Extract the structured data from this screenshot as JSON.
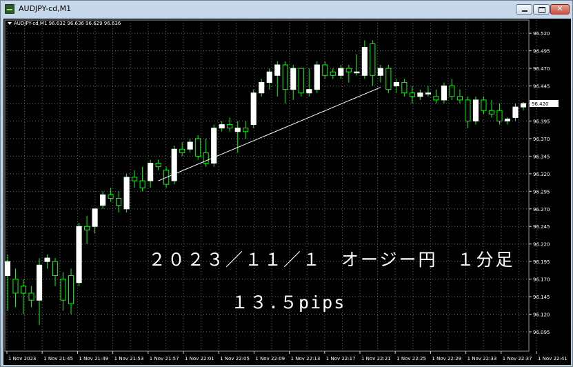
{
  "window": {
    "title": "AUDJPY-cd,M1"
  },
  "chart": {
    "info_line": "AUDJPY-cd,M1  96.632 96.636 96.629 96.636",
    "annotation_title": "２０２３／１１／１　オージー円　１分足",
    "annotation_pips": "１３.５pips"
  },
  "chart_data": {
    "type": "candlestick",
    "symbol": "AUDJPY-cd",
    "timeframe": "M1",
    "ylim": [
      96.095,
      96.53
    ],
    "y_ticks": [
      96.52,
      96.495,
      96.47,
      96.445,
      96.42,
      96.395,
      96.37,
      96.345,
      96.32,
      96.295,
      96.27,
      96.245,
      96.22,
      96.195,
      96.17,
      96.145,
      96.12,
      96.095
    ],
    "y_tick_labels": [
      "96.520",
      "96.495",
      "96.470",
      "96.445",
      "96.420",
      "96.395",
      "96.370",
      "96.345",
      "96.320",
      "96.295",
      "96.270",
      "96.245",
      "96.220",
      "96.195",
      "96.170",
      "96.145",
      "96.120",
      "96.095"
    ],
    "x_tick_labels": [
      "1 Nov 2023",
      "1 Nov 21:45",
      "1 Nov 21:49",
      "1 Nov 21:53",
      "1 Nov 21:57",
      "1 Nov 22:01",
      "1 Nov 22:05",
      "1 Nov 22:09",
      "1 Nov 22:13",
      "1 Nov 22:17",
      "1 Nov 22:21",
      "1 Nov 22:25",
      "1 Nov 22:29",
      "1 Nov 22:33",
      "1 Nov 22:37",
      "1 Nov 22:41"
    ],
    "trendline": {
      "from_index": 19,
      "from_price": 96.31,
      "to_index": 47,
      "to_price": 96.443
    },
    "candles": [
      {
        "o": 96.175,
        "h": 96.205,
        "l": 96.125,
        "c": 96.195
      },
      {
        "o": 96.17,
        "h": 96.185,
        "l": 96.13,
        "c": 96.15
      },
      {
        "o": 96.16,
        "h": 96.17,
        "l": 96.12,
        "c": 96.15
      },
      {
        "o": 96.15,
        "h": 96.16,
        "l": 96.13,
        "c": 96.14
      },
      {
        "o": 96.14,
        "h": 96.2,
        "l": 96.105,
        "c": 96.19
      },
      {
        "o": 96.195,
        "h": 96.205,
        "l": 96.185,
        "c": 96.2
      },
      {
        "o": 96.195,
        "h": 96.2,
        "l": 96.16,
        "c": 96.175
      },
      {
        "o": 96.17,
        "h": 96.18,
        "l": 96.125,
        "c": 96.14
      },
      {
        "o": 96.175,
        "h": 96.185,
        "l": 96.12,
        "c": 96.135
      },
      {
        "o": 96.165,
        "h": 96.25,
        "l": 96.16,
        "c": 96.245
      },
      {
        "o": 96.245,
        "h": 96.26,
        "l": 96.22,
        "c": 96.24
      },
      {
        "o": 96.245,
        "h": 96.265,
        "l": 96.235,
        "c": 96.27
      },
      {
        "o": 96.275,
        "h": 96.295,
        "l": 96.27,
        "c": 96.29
      },
      {
        "o": 96.29,
        "h": 96.3,
        "l": 96.28,
        "c": 96.285
      },
      {
        "o": 96.285,
        "h": 96.295,
        "l": 96.265,
        "c": 96.275
      },
      {
        "o": 96.27,
        "h": 96.32,
        "l": 96.265,
        "c": 96.315
      },
      {
        "o": 96.315,
        "h": 96.325,
        "l": 96.3,
        "c": 96.31
      },
      {
        "o": 96.31,
        "h": 96.33,
        "l": 96.295,
        "c": 96.3
      },
      {
        "o": 96.31,
        "h": 96.34,
        "l": 96.3,
        "c": 96.335
      },
      {
        "o": 96.335,
        "h": 96.34,
        "l": 96.325,
        "c": 96.33
      },
      {
        "o": 96.325,
        "h": 96.33,
        "l": 96.3,
        "c": 96.305
      },
      {
        "o": 96.31,
        "h": 96.36,
        "l": 96.305,
        "c": 96.355
      },
      {
        "o": 96.355,
        "h": 96.365,
        "l": 96.345,
        "c": 96.35
      },
      {
        "o": 96.355,
        "h": 96.37,
        "l": 96.35,
        "c": 96.365
      },
      {
        "o": 96.37,
        "h": 96.375,
        "l": 96.34,
        "c": 96.345
      },
      {
        "o": 96.35,
        "h": 96.37,
        "l": 96.33,
        "c": 96.335
      },
      {
        "o": 96.335,
        "h": 96.39,
        "l": 96.33,
        "c": 96.385
      },
      {
        "o": 96.385,
        "h": 96.395,
        "l": 96.38,
        "c": 96.39
      },
      {
        "o": 96.39,
        "h": 96.4,
        "l": 96.38,
        "c": 96.385
      },
      {
        "o": 96.38,
        "h": 96.395,
        "l": 96.35,
        "c": 96.385
      },
      {
        "o": 96.385,
        "h": 96.395,
        "l": 96.37,
        "c": 96.38
      },
      {
        "o": 96.39,
        "h": 96.44,
        "l": 96.385,
        "c": 96.435
      },
      {
        "o": 96.435,
        "h": 96.455,
        "l": 96.43,
        "c": 96.45
      },
      {
        "o": 96.45,
        "h": 96.47,
        "l": 96.44,
        "c": 96.465
      },
      {
        "o": 96.46,
        "h": 96.48,
        "l": 96.43,
        "c": 96.475
      },
      {
        "o": 96.475,
        "h": 96.48,
        "l": 96.42,
        "c": 96.44
      },
      {
        "o": 96.44,
        "h": 96.475,
        "l": 96.425,
        "c": 96.47
      },
      {
        "o": 96.47,
        "h": 96.47,
        "l": 96.43,
        "c": 96.435
      },
      {
        "o": 96.435,
        "h": 96.47,
        "l": 96.43,
        "c": 96.44
      },
      {
        "o": 96.44,
        "h": 96.48,
        "l": 96.435,
        "c": 96.475
      },
      {
        "o": 96.475,
        "h": 96.48,
        "l": 96.455,
        "c": 96.46
      },
      {
        "o": 96.465,
        "h": 96.47,
        "l": 96.455,
        "c": 96.46
      },
      {
        "o": 96.46,
        "h": 96.475,
        "l": 96.455,
        "c": 96.47
      },
      {
        "o": 96.47,
        "h": 96.475,
        "l": 96.45,
        "c": 96.465
      },
      {
        "o": 96.465,
        "h": 96.49,
        "l": 96.46,
        "c": 96.465
      },
      {
        "o": 96.46,
        "h": 96.51,
        "l": 96.455,
        "c": 96.5
      },
      {
        "o": 96.505,
        "h": 96.51,
        "l": 96.445,
        "c": 96.46
      },
      {
        "o": 96.46,
        "h": 96.475,
        "l": 96.45,
        "c": 96.47
      },
      {
        "o": 96.47,
        "h": 96.475,
        "l": 96.435,
        "c": 96.44
      },
      {
        "o": 96.445,
        "h": 96.455,
        "l": 96.435,
        "c": 96.45
      },
      {
        "o": 96.45,
        "h": 96.455,
        "l": 96.43,
        "c": 96.435
      },
      {
        "o": 96.435,
        "h": 96.445,
        "l": 96.42,
        "c": 96.43
      },
      {
        "o": 96.43,
        "h": 96.44,
        "l": 96.425,
        "c": 96.435
      },
      {
        "o": 96.435,
        "h": 96.445,
        "l": 96.43,
        "c": 96.435
      },
      {
        "o": 96.43,
        "h": 96.44,
        "l": 96.42,
        "c": 96.425
      },
      {
        "o": 96.425,
        "h": 96.45,
        "l": 96.42,
        "c": 96.445
      },
      {
        "o": 96.445,
        "h": 96.455,
        "l": 96.425,
        "c": 96.43
      },
      {
        "o": 96.43,
        "h": 96.44,
        "l": 96.42,
        "c": 96.425
      },
      {
        "o": 96.425,
        "h": 96.43,
        "l": 96.385,
        "c": 96.395
      },
      {
        "o": 96.395,
        "h": 96.43,
        "l": 96.39,
        "c": 96.425
      },
      {
        "o": 96.425,
        "h": 96.43,
        "l": 96.405,
        "c": 96.41
      },
      {
        "o": 96.41,
        "h": 96.425,
        "l": 96.4,
        "c": 96.405
      },
      {
        "o": 96.41,
        "h": 96.42,
        "l": 96.39,
        "c": 96.395
      },
      {
        "o": 96.395,
        "h": 96.4,
        "l": 96.39,
        "c": 96.398
      },
      {
        "o": 96.4,
        "h": 96.42,
        "l": 96.395,
        "c": 96.415
      },
      {
        "o": 96.415,
        "h": 96.422,
        "l": 96.41,
        "c": 96.42
      }
    ]
  },
  "colors": {
    "background": "#000000",
    "grid": "#6f6f6f",
    "candle_body": "#ffffff",
    "wick": "#00ff00",
    "axis_text": "#ffffff"
  }
}
